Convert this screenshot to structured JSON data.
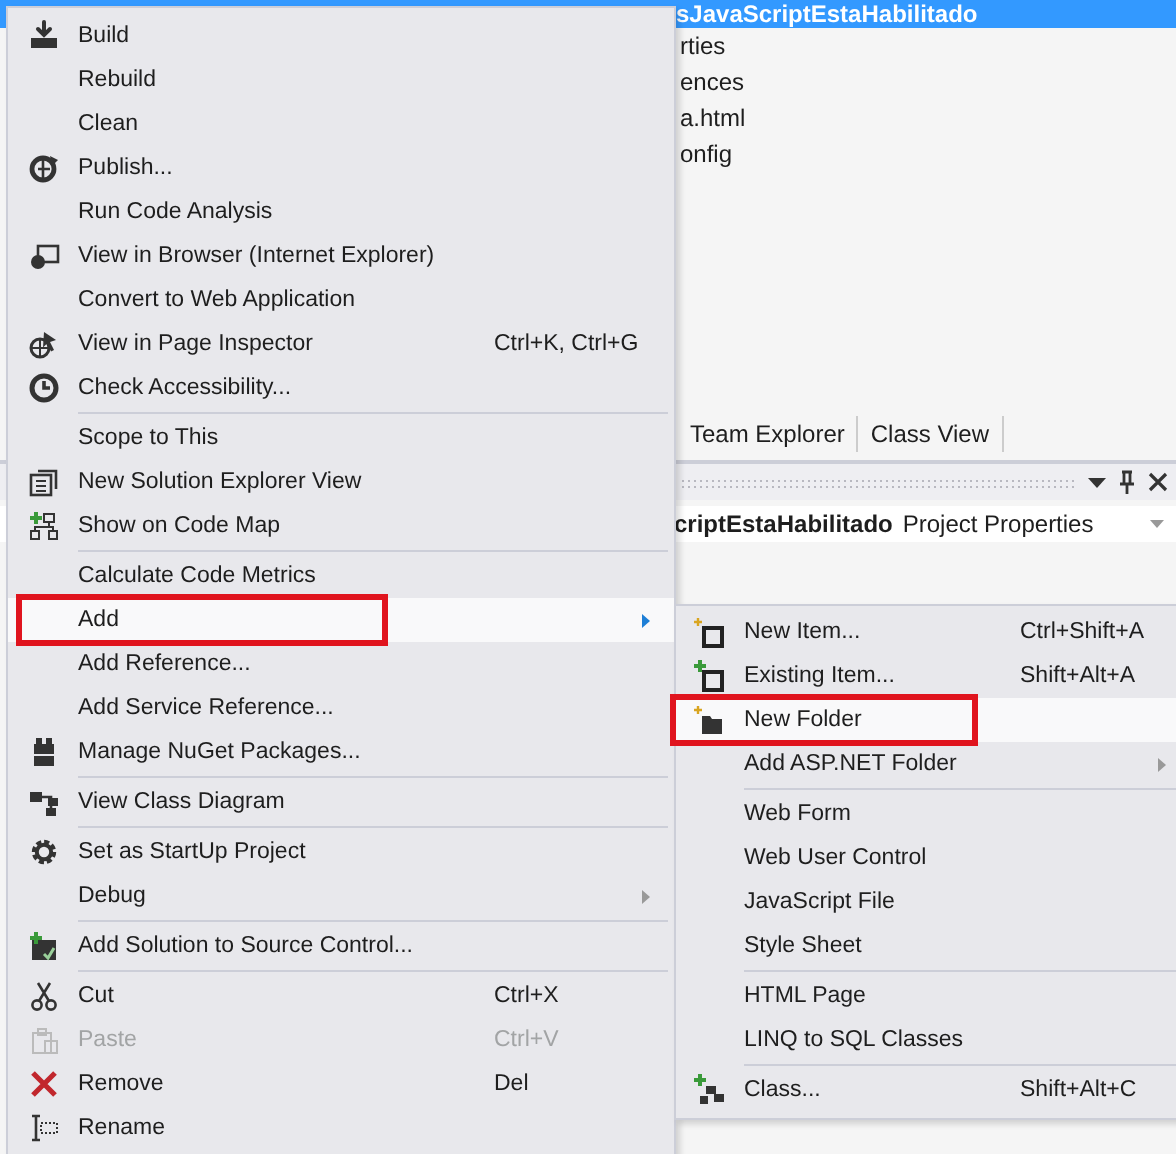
{
  "solution_explorer": {
    "selected_item": "sJavaScriptEstaHabilitado",
    "items": [
      "rties",
      "ences",
      "a.html",
      "onfig"
    ]
  },
  "tabs": [
    "Team Explorer",
    "Class View"
  ],
  "properties": {
    "object_name": "criptEstaHabilitado",
    "object_type": "Project Properties"
  },
  "context_menu": {
    "items": [
      {
        "kind": "item",
        "label": "Build",
        "highlighted": false,
        "disabled": false,
        "marked": false
      },
      {
        "kind": "item",
        "label": "Rebuild",
        "highlighted": false,
        "disabled": false,
        "marked": false
      },
      {
        "kind": "item",
        "label": "Clean",
        "highlighted": false,
        "disabled": false,
        "marked": false
      },
      {
        "kind": "item",
        "label": "Publish...",
        "highlighted": false,
        "disabled": false,
        "marked": false
      },
      {
        "kind": "item",
        "label": "Run Code Analysis",
        "highlighted": false,
        "disabled": false,
        "marked": false
      },
      {
        "kind": "item",
        "label": "View in Browser (Internet Explorer)",
        "highlighted": false,
        "disabled": false,
        "marked": false
      },
      {
        "kind": "item",
        "label": "Convert to Web Application",
        "highlighted": false,
        "disabled": false,
        "marked": false
      },
      {
        "kind": "item",
        "label": "View in Page Inspector",
        "shortcut": "Ctrl+K, Ctrl+G",
        "highlighted": false,
        "disabled": false,
        "marked": false
      },
      {
        "kind": "item",
        "label": "Check Accessibility...",
        "highlighted": false,
        "disabled": false,
        "marked": false
      },
      {
        "kind": "separator"
      },
      {
        "kind": "item",
        "label": "Scope to This",
        "highlighted": false,
        "disabled": false,
        "marked": false
      },
      {
        "kind": "item",
        "label": "New Solution Explorer View",
        "highlighted": false,
        "disabled": false,
        "marked": false
      },
      {
        "kind": "item",
        "label": "Show on Code Map",
        "highlighted": false,
        "disabled": false,
        "marked": false
      },
      {
        "kind": "separator"
      },
      {
        "kind": "item",
        "label": "Calculate Code Metrics",
        "highlighted": false,
        "disabled": false,
        "marked": false
      },
      {
        "kind": "item",
        "label": "Add",
        "has_submenu": true,
        "highlighted": true,
        "disabled": false,
        "marked": true
      },
      {
        "kind": "item",
        "label": "Add Reference...",
        "highlighted": false,
        "disabled": false,
        "marked": false
      },
      {
        "kind": "item",
        "label": "Add Service Reference...",
        "highlighted": false,
        "disabled": false,
        "marked": false
      },
      {
        "kind": "item",
        "label": "Manage NuGet Packages...",
        "highlighted": false,
        "disabled": false,
        "marked": false
      },
      {
        "kind": "separator"
      },
      {
        "kind": "item",
        "label": "View Class Diagram",
        "highlighted": false,
        "disabled": false,
        "marked": false
      },
      {
        "kind": "separator"
      },
      {
        "kind": "item",
        "label": "Set as StartUp Project",
        "highlighted": false,
        "disabled": false,
        "marked": false
      },
      {
        "kind": "item",
        "label": "Debug",
        "has_submenu": true,
        "highlighted": false,
        "disabled": false,
        "marked": false
      },
      {
        "kind": "separator"
      },
      {
        "kind": "item",
        "label": "Add Solution to Source Control...",
        "highlighted": false,
        "disabled": false,
        "marked": false
      },
      {
        "kind": "separator"
      },
      {
        "kind": "item",
        "label": "Cut",
        "shortcut": "Ctrl+X",
        "highlighted": false,
        "disabled": false,
        "marked": false
      },
      {
        "kind": "item",
        "label": "Paste",
        "shortcut": "Ctrl+V",
        "highlighted": false,
        "disabled": true,
        "marked": false
      },
      {
        "kind": "item",
        "label": "Remove",
        "shortcut": "Del",
        "highlighted": false,
        "disabled": false,
        "marked": false
      },
      {
        "kind": "item",
        "label": "Rename",
        "highlighted": false,
        "disabled": false,
        "marked": false
      }
    ]
  },
  "submenu": {
    "items": [
      {
        "kind": "item",
        "label": "New Item...",
        "shortcut": "Ctrl+Shift+A",
        "highlighted": false,
        "disabled": false,
        "marked": false
      },
      {
        "kind": "item",
        "label": "Existing Item...",
        "shortcut": "Shift+Alt+A",
        "highlighted": false,
        "disabled": false,
        "marked": false
      },
      {
        "kind": "item",
        "label": "New Folder",
        "highlighted": true,
        "disabled": false,
        "marked": true
      },
      {
        "kind": "item",
        "label": "Add ASP.NET Folder",
        "has_submenu": true,
        "highlighted": false,
        "disabled": false,
        "marked": false
      },
      {
        "kind": "separator"
      },
      {
        "kind": "item",
        "label": "Web Form",
        "highlighted": false,
        "disabled": false,
        "marked": false
      },
      {
        "kind": "item",
        "label": "Web User Control",
        "highlighted": false,
        "disabled": false,
        "marked": false
      },
      {
        "kind": "item",
        "label": "JavaScript File",
        "highlighted": false,
        "disabled": false,
        "marked": false
      },
      {
        "kind": "item",
        "label": "Style Sheet",
        "highlighted": false,
        "disabled": false,
        "marked": false
      },
      {
        "kind": "separator"
      },
      {
        "kind": "item",
        "label": "HTML Page",
        "highlighted": false,
        "disabled": false,
        "marked": false
      },
      {
        "kind": "item",
        "label": "LINQ to SQL Classes",
        "highlighted": false,
        "disabled": false,
        "marked": false
      },
      {
        "kind": "separator"
      },
      {
        "kind": "item",
        "label": "Class...",
        "shortcut": "Shift+Alt+C",
        "highlighted": false,
        "disabled": false,
        "marked": false
      }
    ]
  }
}
